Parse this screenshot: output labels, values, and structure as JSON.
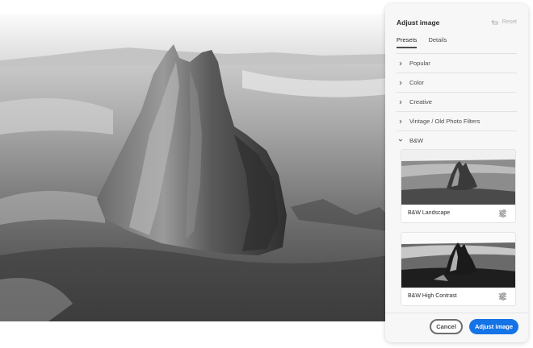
{
  "panel": {
    "title": "Adjust image",
    "reset_label": "Reset",
    "reset_icon": "reset-icon"
  },
  "tabs": [
    {
      "label": "Presets",
      "active": true
    },
    {
      "label": "Details",
      "active": false
    }
  ],
  "categories": [
    {
      "label": "Popular",
      "expanded": false
    },
    {
      "label": "Color",
      "expanded": false
    },
    {
      "label": "Creative",
      "expanded": false
    },
    {
      "label": "Vintage / Old Photo Filters",
      "expanded": false
    },
    {
      "label": "B&W",
      "expanded": true
    }
  ],
  "presets": [
    {
      "label": "B&W Landscape",
      "icon": "sliders-icon"
    },
    {
      "label": "B&W High Contrast",
      "icon": "sliders-icon"
    }
  ],
  "footer": {
    "cancel_label": "Cancel",
    "apply_label": "Adjust image"
  },
  "colors": {
    "accent": "#1473e6",
    "panel_bg": "#f7f7f7",
    "text": "#2c2c2c",
    "muted": "#b3b3b3"
  }
}
